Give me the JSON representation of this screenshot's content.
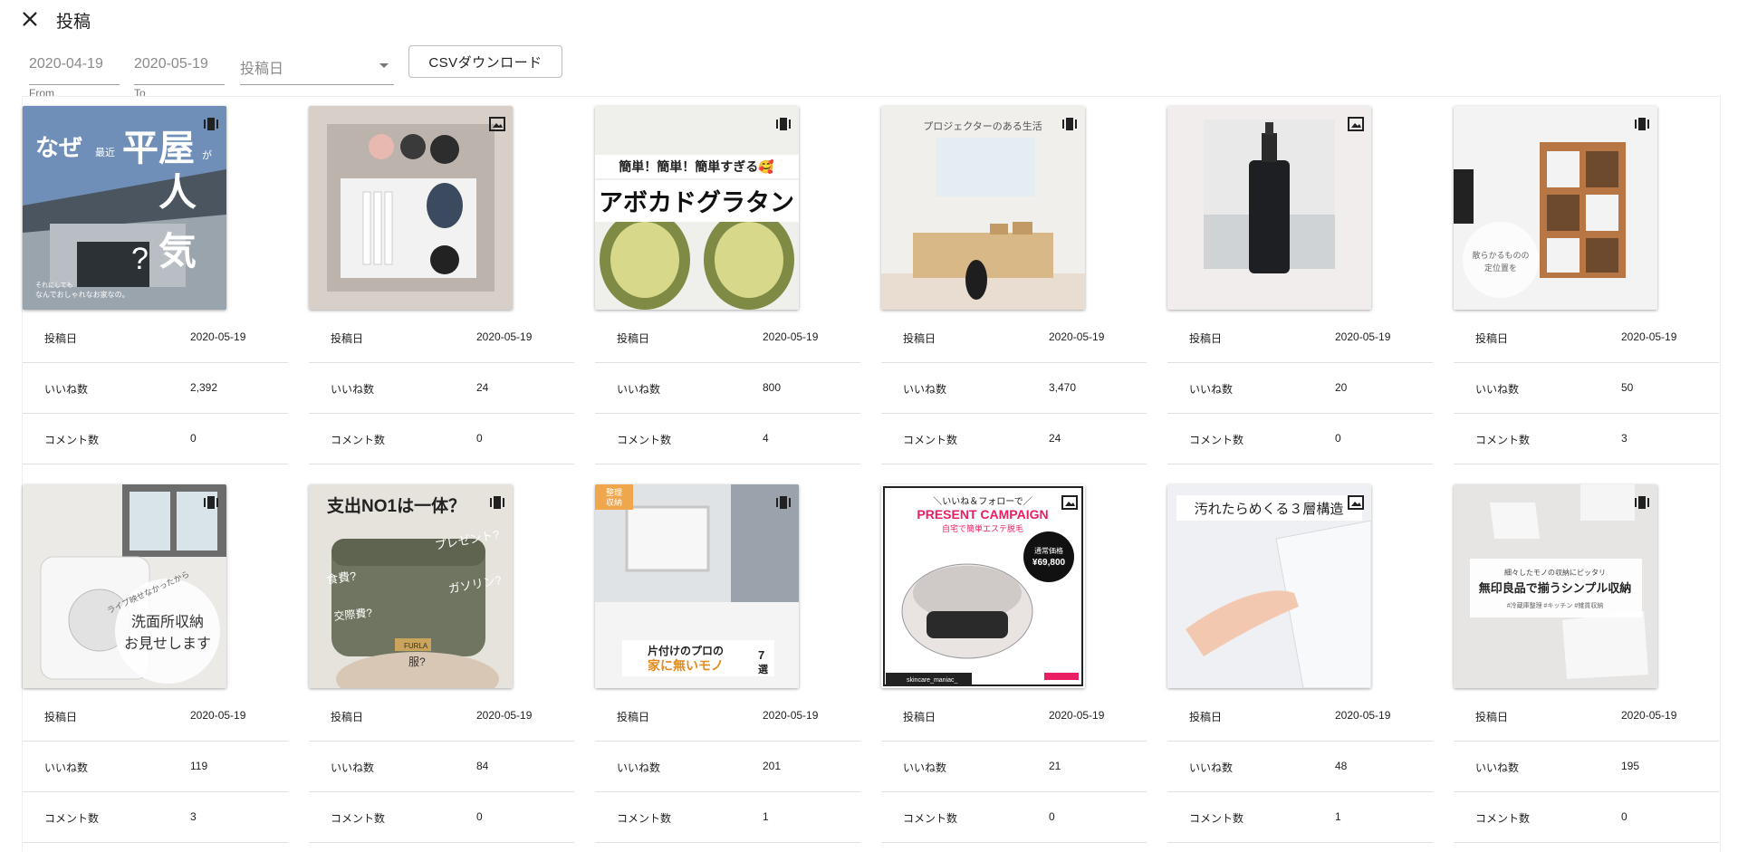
{
  "header": {
    "title": "投稿"
  },
  "filters": {
    "from_value": "2020-04-19",
    "from_label": "From",
    "to_value": "2020-05-19",
    "to_label": "To",
    "sort_value": "投稿日",
    "csv_label": "CSVダウンロード"
  },
  "labels": {
    "date": "投稿日",
    "likes": "いいね数",
    "comments": "コメント数"
  },
  "posts": [
    {
      "type": "carousel",
      "date": "2020-05-19",
      "likes": "2,392",
      "comments": "0",
      "caption": [
        "なぜ",
        "最近",
        "平屋",
        "が",
        "人",
        "気",
        "?",
        "それにしても",
        "なんでおしゃれなお家なの。"
      ]
    },
    {
      "type": "image",
      "date": "2020-05-19",
      "likes": "24",
      "comments": "0"
    },
    {
      "type": "carousel",
      "date": "2020-05-19",
      "likes": "800",
      "comments": "4",
      "caption": [
        "簡単！簡単！簡単すぎる🥰",
        "アボカドグラタン"
      ]
    },
    {
      "type": "carousel",
      "date": "2020-05-19",
      "likes": "3,470",
      "comments": "24",
      "caption": [
        "プロジェクターのある生活"
      ]
    },
    {
      "type": "image",
      "date": "2020-05-19",
      "likes": "20",
      "comments": "0"
    },
    {
      "type": "carousel",
      "date": "2020-05-19",
      "likes": "50",
      "comments": "3",
      "caption": [
        "散らかるものの",
        "定位置を"
      ]
    },
    {
      "type": "carousel",
      "date": "2020-05-19",
      "likes": "119",
      "comments": "3",
      "caption": [
        "ライブ映せなかったから",
        "洗面所収納",
        "お見せします"
      ]
    },
    {
      "type": "carousel",
      "date": "2020-05-19",
      "likes": "84",
      "comments": "0",
      "caption": [
        "支出NO1は一体？",
        "プレゼント?",
        "食費?",
        "交際費?",
        "服?",
        "ガソリン?",
        "FURLA"
      ]
    },
    {
      "type": "carousel",
      "date": "2020-05-19",
      "likes": "201",
      "comments": "1",
      "caption": [
        "整理",
        "収納",
        "片付けのプロの",
        "家に無いモノ",
        "7",
        "選"
      ]
    },
    {
      "type": "image",
      "date": "2020-05-19",
      "likes": "21",
      "comments": "0",
      "caption": [
        "＼いいね＆フォローで／",
        "PRESENT CAMPAIGN",
        "自宅で簡単エステ脱毛",
        "通常価格",
        "¥69,800",
        "skincare_maniac_"
      ]
    },
    {
      "type": "image",
      "date": "2020-05-19",
      "likes": "48",
      "comments": "1",
      "caption": [
        "汚れたらめくる３層構造"
      ]
    },
    {
      "type": "carousel",
      "date": "2020-05-19",
      "likes": "195",
      "comments": "0",
      "caption": [
        "細々したモノの収納にピッタリ",
        "無印良品で揃うシンプル収納",
        "#冷蔵庫整理 #キッチン #雑貨収納"
      ]
    }
  ],
  "colors": {
    "accent_orange": "#ff9800",
    "pink": "#e91e63",
    "text": "#212121",
    "muted": "#757575"
  }
}
